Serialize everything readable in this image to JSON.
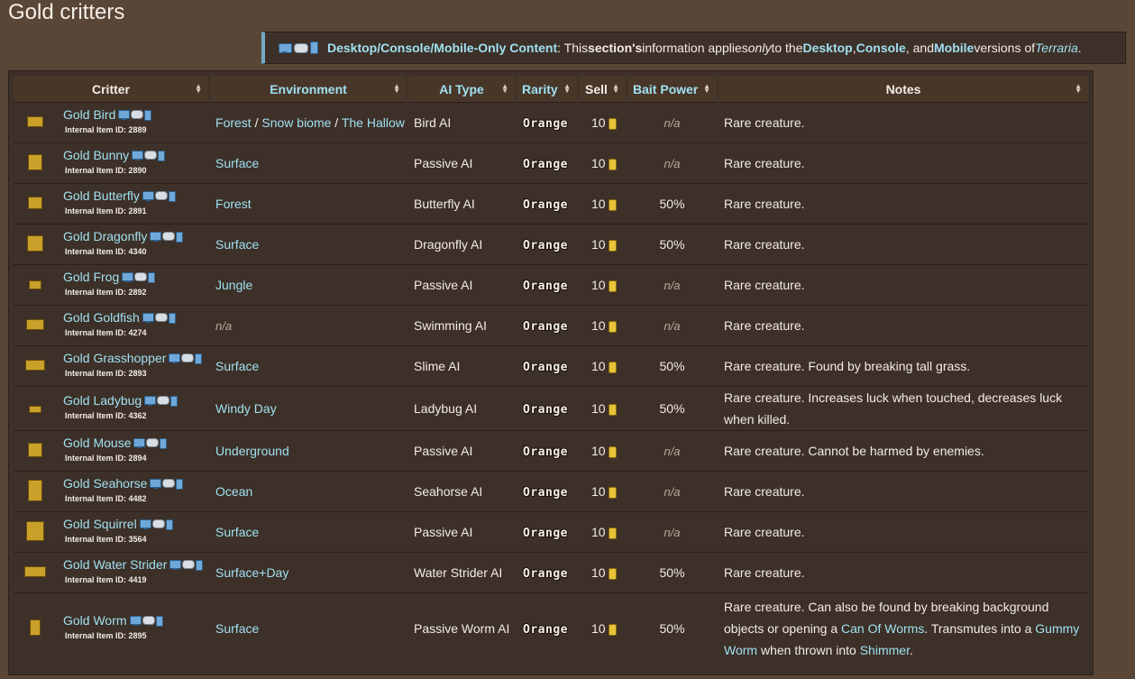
{
  "page": {
    "title": "Gold critters"
  },
  "notice": {
    "versions": "Desktop/Console/Mobile-Only Content",
    "colon": ": This ",
    "section": "section's",
    "mid": " information applies ",
    "only": "only",
    "to_the": " to the ",
    "desktop": "Desktop",
    "comma": ", ",
    "console": "Console",
    "and": ", and ",
    "mobile": "Mobile",
    "versions_of": " versions of ",
    "game": "Terraria",
    "period": "."
  },
  "table": {
    "headers": [
      "Critter",
      "Environment",
      "AI Type",
      "Rarity",
      "Sell",
      "Bait Power",
      "Notes"
    ],
    "iid_label": "Internal Item ID: ",
    "rows": [
      {
        "name": "Gold Bird",
        "id": "2889",
        "env": [
          "Forest",
          "Snow biome",
          "The Hallow"
        ],
        "ai": "Bird AI",
        "rarity": "Orange",
        "sell": "10",
        "bait": "n/a",
        "notes": "Rare creature."
      },
      {
        "name": "Gold Bunny",
        "id": "2890",
        "env": [
          "Surface"
        ],
        "ai": "Passive AI",
        "rarity": "Orange",
        "sell": "10",
        "bait": "n/a",
        "notes": "Rare creature."
      },
      {
        "name": "Gold Butterfly",
        "id": "2891",
        "env": [
          "Forest"
        ],
        "ai": "Butterfly AI",
        "rarity": "Orange",
        "sell": "10",
        "bait": "50%",
        "notes": "Rare creature."
      },
      {
        "name": "Gold Dragonfly",
        "id": "4340",
        "env": [
          "Surface"
        ],
        "ai": "Dragonfly AI",
        "rarity": "Orange",
        "sell": "10",
        "bait": "50%",
        "notes": "Rare creature."
      },
      {
        "name": "Gold Frog",
        "id": "2892",
        "env": [
          "Jungle"
        ],
        "ai": "Passive AI",
        "rarity": "Orange",
        "sell": "10",
        "bait": "n/a",
        "notes": "Rare creature."
      },
      {
        "name": "Gold Goldfish",
        "id": "4274",
        "env": [],
        "env_na": "n/a",
        "ai": "Swimming AI",
        "rarity": "Orange",
        "sell": "10",
        "bait": "n/a",
        "notes": "Rare creature."
      },
      {
        "name": "Gold Grasshopper",
        "id": "2893",
        "env": [
          "Surface"
        ],
        "ai": "Slime AI",
        "rarity": "Orange",
        "sell": "10",
        "bait": "50%",
        "notes": "Rare creature. Found by breaking tall grass."
      },
      {
        "name": "Gold Ladybug",
        "id": "4362",
        "env": [
          "Windy Day"
        ],
        "ai": "Ladybug AI",
        "rarity": "Orange",
        "sell": "10",
        "bait": "50%",
        "notes": "Rare creature. Increases luck when touched, decreases luck when killed."
      },
      {
        "name": "Gold Mouse",
        "id": "2894",
        "env": [
          "Underground"
        ],
        "ai": "Passive AI",
        "rarity": "Orange",
        "sell": "10",
        "bait": "n/a",
        "notes": "Rare creature. Cannot be harmed by enemies."
      },
      {
        "name": "Gold Seahorse",
        "id": "4482",
        "env": [
          "Ocean"
        ],
        "ai": "Seahorse AI",
        "rarity": "Orange",
        "sell": "10",
        "bait": "n/a",
        "notes": "Rare creature."
      },
      {
        "name": "Gold Squirrel",
        "id": "3564",
        "env": [
          "Surface"
        ],
        "ai": "Passive AI",
        "rarity": "Orange",
        "sell": "10",
        "bait": "n/a",
        "notes": "Rare creature."
      },
      {
        "name": "Gold Water Strider",
        "id": "4419",
        "env": [
          "Surface+Day"
        ],
        "ai": "Water Strider AI",
        "rarity": "Orange",
        "sell": "10",
        "bait": "50%",
        "notes": "Rare creature."
      },
      {
        "name": "Gold Worm",
        "id": "2895",
        "env": [
          "Surface"
        ],
        "ai": "Passive Worm AI",
        "rarity": "Orange",
        "sell": "10",
        "bait": "50%",
        "notes_parts": [
          {
            "t": "Rare creature. Can also be found by breaking background objects or opening a ",
            "link": false
          },
          {
            "t": "Can Of Worms",
            "link": true
          },
          {
            "t": ". Transmutes into a ",
            "link": false
          },
          {
            "t": "Gummy Worm",
            "link": true
          },
          {
            "t": " when thrown into ",
            "link": false
          },
          {
            "t": "Shimmer",
            "link": true
          },
          {
            "t": ".",
            "link": false
          }
        ]
      }
    ]
  }
}
